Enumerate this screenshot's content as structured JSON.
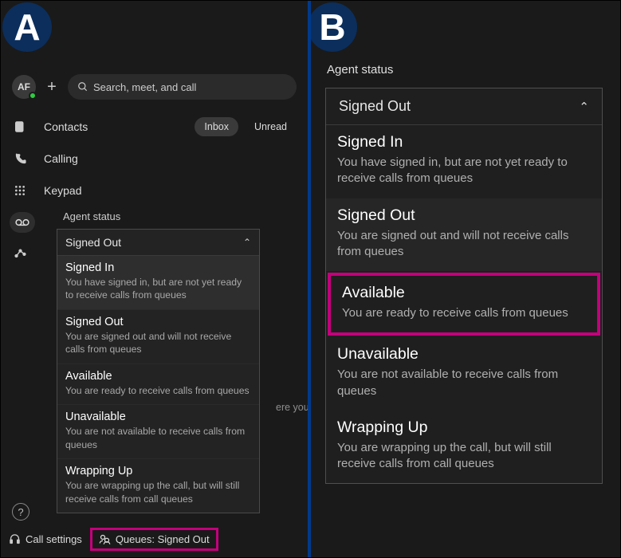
{
  "markers": {
    "a": "A",
    "b": "B"
  },
  "panelA": {
    "avatar_text": "AF",
    "search_placeholder": "Search, meet, and call",
    "nav": {
      "contacts": "Contacts",
      "calling": "Calling",
      "keypad": "Keypad"
    },
    "pills": {
      "inbox": "Inbox",
      "unread": "Unread"
    },
    "bg_text": "ere you'll",
    "footer": {
      "call_settings": "Call settings",
      "queues": "Queues: Signed Out"
    }
  },
  "agent_status": {
    "title": "Agent status",
    "selected": "Signed Out",
    "options": [
      {
        "title": "Signed In",
        "desc": "You have signed in, but are not yet ready to receive calls from queues"
      },
      {
        "title": "Signed Out",
        "desc": "You are signed out and will not receive calls from queues"
      },
      {
        "title": "Available",
        "desc": "You are ready to receive calls from queues"
      },
      {
        "title": "Unavailable",
        "desc": "You are not available to receive calls from queues"
      },
      {
        "title": "Wrapping Up",
        "desc": "You are wrapping up the call, but will still receive calls from call queues"
      }
    ]
  }
}
